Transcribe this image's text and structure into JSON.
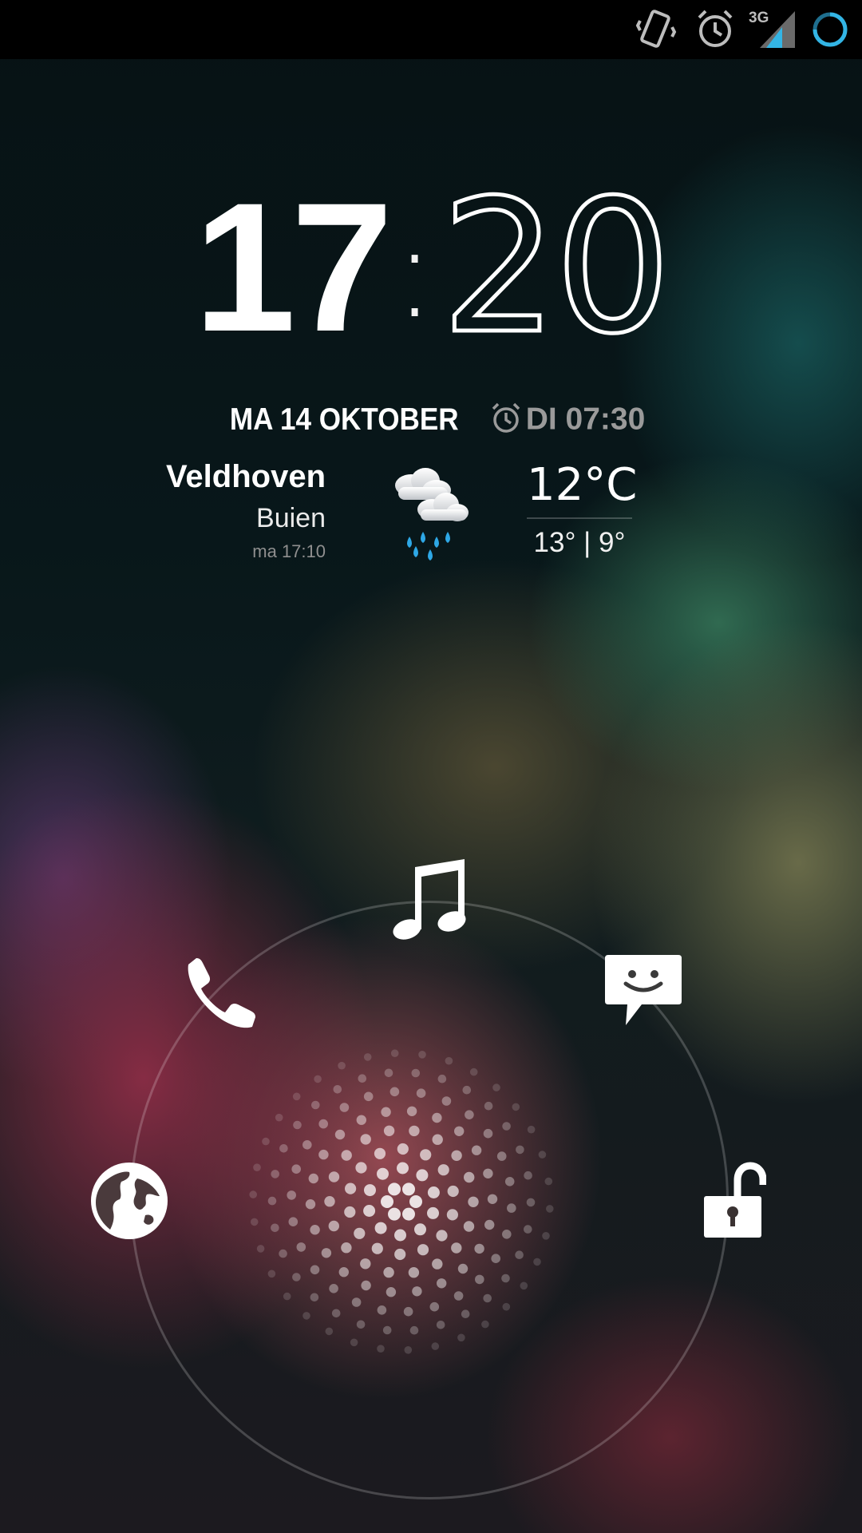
{
  "status_bar": {
    "icons": [
      "vibrate-icon",
      "alarm-icon",
      "signal-icon",
      "sync-icon"
    ],
    "network_type": "3G",
    "accent_color": "#33b5e5"
  },
  "clock": {
    "hours": "17",
    "separator": ":",
    "minutes": "20"
  },
  "date": {
    "text": "MA 14 OKTOBER"
  },
  "alarm": {
    "icon": "alarm-icon",
    "text": "DI 07:30"
  },
  "weather": {
    "city": "Veldhoven",
    "condition": "Buien",
    "updated": "ma 17:10",
    "icon": "rain-cloud-icon",
    "temperature": "12°C",
    "high_low": "13° | 9°"
  },
  "glowpad": {
    "targets": [
      {
        "icon": "music-icon",
        "position": "top"
      },
      {
        "icon": "phone-icon",
        "position": "upper-left"
      },
      {
        "icon": "message-icon",
        "position": "upper-right"
      },
      {
        "icon": "browser-globe-icon",
        "position": "left"
      },
      {
        "icon": "unlock-icon",
        "position": "right"
      }
    ]
  }
}
